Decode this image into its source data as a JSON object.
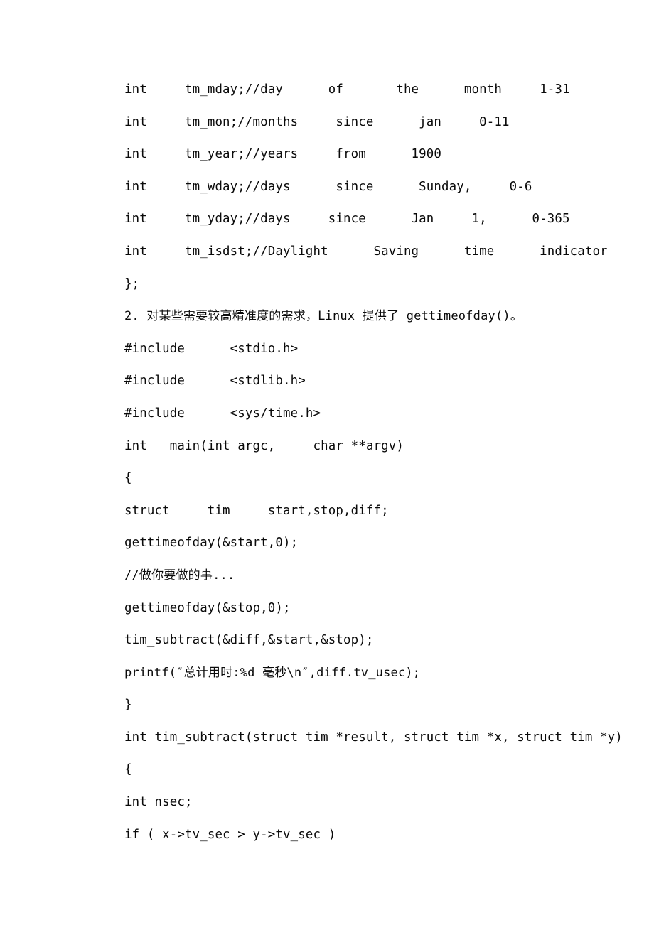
{
  "document": {
    "page_background": "#ffffff",
    "text_color": "#0a0a0a",
    "lines": [
      {
        "id": "struct-field-tm-mday",
        "text": "int     tm_mday;//day      of       the      month     1-31",
        "script": "latin"
      },
      {
        "id": "struct-field-tm-mon",
        "text": "int     tm_mon;//months     since      jan     0-11",
        "script": "latin"
      },
      {
        "id": "struct-field-tm-year",
        "text": "int     tm_year;//years     from      1900",
        "script": "latin"
      },
      {
        "id": "struct-field-tm-wday",
        "text": "int     tm_wday;//days      since      Sunday,     0-6",
        "script": "latin"
      },
      {
        "id": "struct-field-tm-yday",
        "text": "int     tm_yday;//days     since      Jan     1,      0-365",
        "script": "latin"
      },
      {
        "id": "struct-field-tm-isdst",
        "text": "int     tm_isdst;//Daylight      Saving      time      indicator",
        "script": "latin"
      },
      {
        "id": "struct-close",
        "text": "};",
        "script": "latin"
      },
      {
        "id": "paragraph-item-2",
        "text": "2. 对某些需要较高精准度的需求，Linux 提供了 gettimeofday()。",
        "script": "cjk"
      },
      {
        "id": "include-stdio",
        "text": "#include      <stdio.h>",
        "script": "latin"
      },
      {
        "id": "include-stdlib",
        "text": "#include      <stdlib.h>",
        "script": "latin"
      },
      {
        "id": "include-sys-time",
        "text": "#include      <sys/time.h>",
        "script": "latin"
      },
      {
        "id": "main-signature",
        "text": "int   main(int argc,     char **argv)",
        "script": "latin"
      },
      {
        "id": "main-open-brace",
        "text": "{",
        "script": "latin"
      },
      {
        "id": "decl-struct-tim",
        "text": "struct     tim     start,stop,diff;",
        "script": "latin"
      },
      {
        "id": "call-gettimeofday-start",
        "text": "gettimeofday(&start,0);",
        "script": "latin"
      },
      {
        "id": "comment-do-your-work",
        "text": "//做你要做的事...",
        "script": "cjk"
      },
      {
        "id": "call-gettimeofday-stop",
        "text": "gettimeofday(&stop,0);",
        "script": "latin"
      },
      {
        "id": "call-tim-subtract",
        "text": "tim_subtract(&diff,&start,&stop);",
        "script": "latin"
      },
      {
        "id": "call-printf-total",
        "text": "printf(″总计用时:%d 毫秒\\n″,diff.tv_usec);",
        "script": "cjk"
      },
      {
        "id": "main-close-brace",
        "text": "}",
        "script": "latin"
      },
      {
        "id": "tim-subtract-signature",
        "text": "int tim_subtract(struct tim *result, struct tim *x, struct tim *y)",
        "script": "latin"
      },
      {
        "id": "tim-subtract-open-brace",
        "text": "{",
        "script": "latin"
      },
      {
        "id": "decl-int-nsec",
        "text": "int nsec;",
        "script": "latin"
      },
      {
        "id": "if-tv-sec-compare",
        "text": "if ( x->tv_sec > y->tv_sec )",
        "script": "latin"
      }
    ]
  }
}
